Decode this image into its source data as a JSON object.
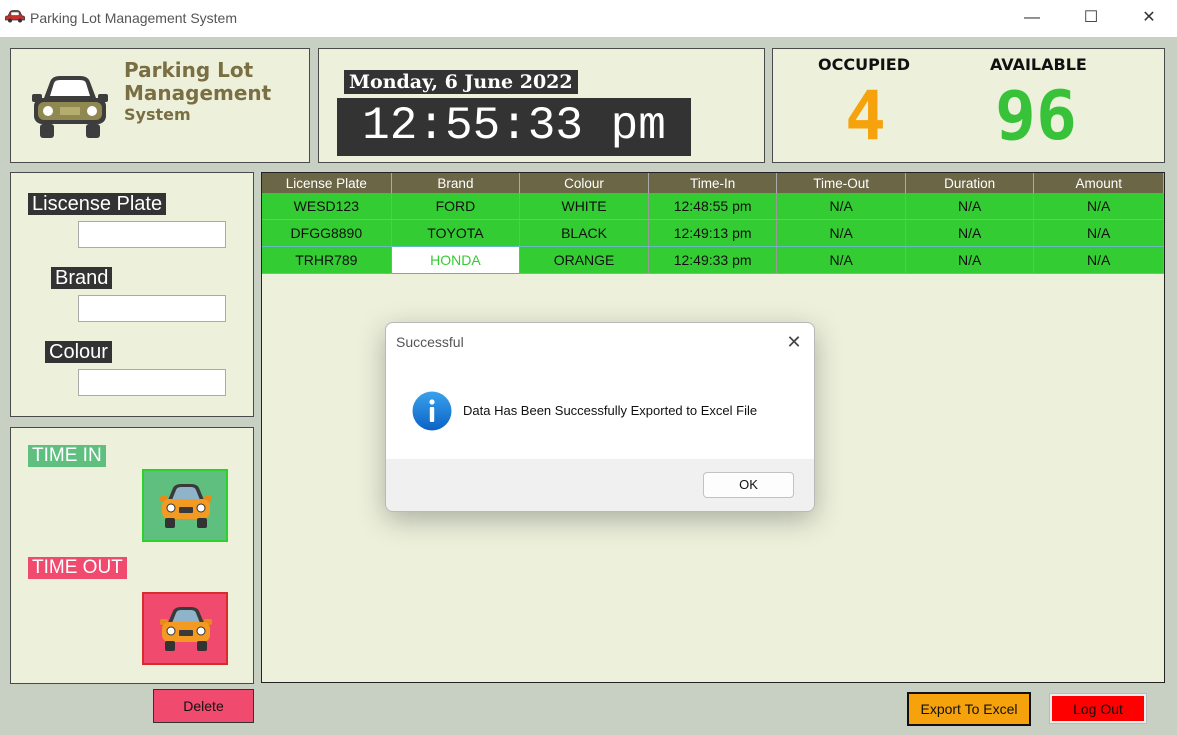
{
  "window": {
    "title": "Parking Lot Management System"
  },
  "logo": {
    "line1": "Parking Lot",
    "line2": "Management",
    "line3": "System"
  },
  "clock": {
    "date": "Monday, 6 June 2022",
    "time": "12:55:33 pm"
  },
  "stats": {
    "occupied_label": "OCCUPIED",
    "occupied_value": "4",
    "available_label": "AVAILABLE",
    "available_value": "96",
    "occupied_color": "#f5a20c",
    "available_color": "#38c23a"
  },
  "form": {
    "plate_label": "Liscense Plate",
    "plate_value": "",
    "brand_label": "Brand",
    "brand_value": "",
    "colour_label": "Colour",
    "colour_value": ""
  },
  "actions": {
    "time_in_label": "TIME IN",
    "time_out_label": "TIME OUT",
    "delete_label": "Delete",
    "export_label": "Export To Excel",
    "logout_label": "Log Out"
  },
  "table": {
    "columns": [
      "License Plate",
      "Brand",
      "Colour",
      "Time-In",
      "Time-Out",
      "Duration",
      "Amount"
    ],
    "rows": [
      [
        "WESD123",
        "FORD",
        "WHITE",
        "12:48:55 pm",
        "N/A",
        "N/A",
        "N/A"
      ],
      [
        "DFGG8890",
        "TOYOTA",
        "BLACK",
        "12:49:13 pm",
        "N/A",
        "N/A",
        "N/A"
      ],
      [
        "TRHR789",
        "HONDA",
        "ORANGE",
        "12:49:33 pm",
        "N/A",
        "N/A",
        "N/A"
      ]
    ]
  },
  "dialog": {
    "title": "Successful",
    "message": "Data Has Been Successfully Exported to Excel File",
    "ok_label": "OK",
    "icon": "info-icon"
  },
  "colors": {
    "row_green": "#33cc33",
    "header": "#6b6646",
    "panel": "#edf1dc"
  }
}
